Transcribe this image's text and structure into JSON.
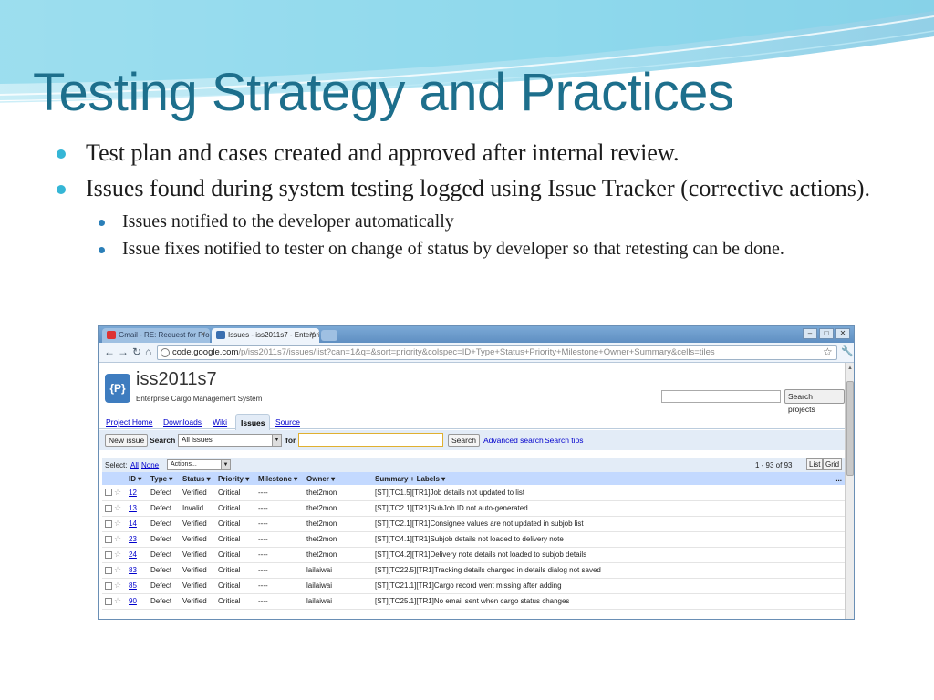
{
  "slide": {
    "title": "Testing Strategy and Practices",
    "bullets": [
      "Test plan and cases created and approved after internal review.",
      "Issues found during system testing logged using Issue Tracker (corrective actions)."
    ],
    "sub_bullets": [
      "Issues notified to the developer automatically",
      "Issue fixes notified to tester  on change of status by developer so that retesting can be done."
    ]
  },
  "browser": {
    "tabs": [
      {
        "label": "Gmail - RE: Request for Pro"
      },
      {
        "label": "Issues - iss2011s7 - Enterpri"
      }
    ],
    "url_host": "code.google.com",
    "url_path": "/p/iss2011s7/issues/list?can=1&q=&sort=priority&colspec=ID+Type+Status+Priority+Milestone+Owner+Summary&cells=tiles"
  },
  "project": {
    "logo": "{P}",
    "name": "iss2011s7",
    "subtitle": "Enterprise Cargo Management System",
    "search_button": "Search projects"
  },
  "nav": {
    "items": [
      "Project Home",
      "Downloads",
      "Wiki",
      "Issues",
      "Source"
    ]
  },
  "issue_search": {
    "new_issue": "New issue",
    "search_label": "Search",
    "scope": "All issues",
    "for_label": "for",
    "search_button": "Search",
    "advanced": "Advanced search",
    "tips": "Search tips"
  },
  "selection": {
    "select_label": "Select:",
    "all": "All",
    "none": "None",
    "actions": "Actions...",
    "count": "1 - 93 of 93",
    "list": "List",
    "grid": "Grid"
  },
  "table": {
    "headers": [
      "ID ▾",
      "Type ▾",
      "Status ▾",
      "Priority ▾",
      "Milestone ▾",
      "Owner ▾",
      "Summary + Labels ▾",
      "..."
    ],
    "rows": [
      {
        "id": "12",
        "type": "Defect",
        "status": "Verified",
        "priority": "Critical",
        "milestone": "----",
        "owner": "thet2mon",
        "summary": "[ST][TC1.5][TR1]Job details not updated to list"
      },
      {
        "id": "13",
        "type": "Defect",
        "status": "Invalid",
        "priority": "Critical",
        "milestone": "----",
        "owner": "thet2mon",
        "summary": "[ST][TC2.1][TR1]SubJob ID not auto-generated"
      },
      {
        "id": "14",
        "type": "Defect",
        "status": "Verified",
        "priority": "Critical",
        "milestone": "----",
        "owner": "thet2mon",
        "summary": "[ST][TC2.1][TR1]Consignee values are not updated in subjob list"
      },
      {
        "id": "23",
        "type": "Defect",
        "status": "Verified",
        "priority": "Critical",
        "milestone": "----",
        "owner": "thet2mon",
        "summary": "[ST][TC4.1][TR1]Subjob details not loaded to delivery note"
      },
      {
        "id": "24",
        "type": "Defect",
        "status": "Verified",
        "priority": "Critical",
        "milestone": "----",
        "owner": "thet2mon",
        "summary": "[ST][TC4.2][TR1]Delivery note details not loaded to subjob details"
      },
      {
        "id": "83",
        "type": "Defect",
        "status": "Verified",
        "priority": "Critical",
        "milestone": "----",
        "owner": "lailaiwai",
        "summary": "[ST][TC22.5][TR1]Tracking details changed in details dialog not saved"
      },
      {
        "id": "85",
        "type": "Defect",
        "status": "Verified",
        "priority": "Critical",
        "milestone": "----",
        "owner": "lailaiwai",
        "summary": "[ST][TC21.1][TR1]Cargo record went missing after adding"
      },
      {
        "id": "90",
        "type": "Defect",
        "status": "Verified",
        "priority": "Critical",
        "milestone": "----",
        "owner": "lailaiwai",
        "summary": "[ST][TC25.1][TR1]No email sent when cargo status changes"
      }
    ]
  },
  "colors": {
    "title": "#1d6f8c",
    "bullet": "#35b6d6",
    "table_header": "#c3d9ff",
    "link": "#0000cc"
  }
}
